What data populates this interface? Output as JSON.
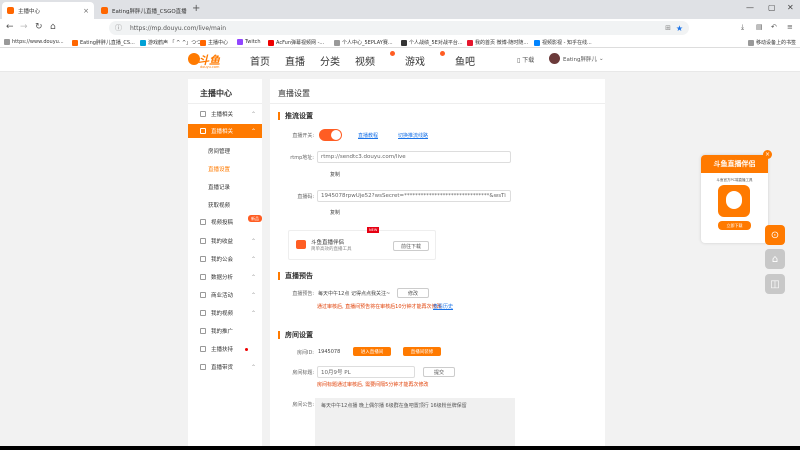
{
  "browser": {
    "tabs": [
      {
        "label": "主播中心",
        "active": true
      },
      {
        "label": "Eating胖胖儿直播_CSGO直播",
        "active": false
      }
    ],
    "url": "https://mp.douyu.com/live/main",
    "bookmarks": [
      "https://www.douyu...",
      "Eating胖胖儿直播_CS...",
      "游戏鹤声 「 ^ ^」つつ...",
      "主播中心",
      "Twitch",
      "AcFun弹幕视频网 -...",
      "个人中心_5EPLAY赛...",
      "个人战绩_5E对战平台...",
      "我的首页 微博-随时随...",
      "视频影视 - 知乎在线...",
      "移动设备上的书签"
    ]
  },
  "site": {
    "logo": "斗鱼",
    "logo_sub": "douyu.com",
    "nav": [
      "首页",
      "直播",
      "分类",
      "视频",
      "游戏",
      "鱼吧"
    ],
    "download": "下载",
    "username": "Eating胖胖儿"
  },
  "sidebar": {
    "title": "主播中心",
    "items": [
      {
        "label": "主播相关"
      },
      {
        "label": "直播相关"
      },
      {
        "label": "视频投稿"
      },
      {
        "label": "我的收益"
      },
      {
        "label": "我的公会"
      },
      {
        "label": "数据分析"
      },
      {
        "label": "商业活动"
      },
      {
        "label": "我的视频"
      },
      {
        "label": "我的推广"
      },
      {
        "label": "主播扶持"
      },
      {
        "label": "直播带货"
      }
    ],
    "subitems": [
      "房间管理",
      "直播设置",
      "直播记录",
      "获取视频"
    ],
    "new_badge": "新品"
  },
  "main": {
    "title": "直播设置",
    "stream": {
      "section": "推流设置",
      "switch_label": "直播开关:",
      "link1": "直播教程",
      "link2": "切换推流线路",
      "rtmp_label": "rtmp地址:",
      "rtmp_value": "rtmp://sendtc3.douyu.com/live",
      "copy": "复制",
      "code_label": "直播码:",
      "code_value": "1945078rpwUje52?wsSecret=*******************************&wsTi",
      "copy2": "复制"
    },
    "promo": {
      "title": "斗鱼直播伴侣",
      "subtitle": "简单高效的直播工具",
      "download": "前往下载",
      "badge": "NEW"
    },
    "notice": {
      "section": "直播预告",
      "label": "直播预告:",
      "value": "每天中午12点  记得点点我关注~",
      "edit": "修改",
      "warn": "通过审核后, 直播间预告将在审核后10分钟才能再次修改",
      "history": "查看历史"
    },
    "room": {
      "section": "房间设置",
      "id_label": "房间ID:",
      "id_value": "1945078",
      "btn1": "进入直播间",
      "btn2": "直播间装修",
      "title_label": "房间标题:",
      "title_value": "10月9号 PL",
      "submit": "提交",
      "warn": "房间标题通过审核后, 需要间隔5分钟才能再次修改",
      "announce_label": "房间公告:",
      "announce_value": "每天中午12点播 晚上偶尔播 6级群在鱼吧置顶行 16级粉丝牌保留"
    }
  },
  "ad": {
    "title": "斗鱼直播伴侣",
    "subtitle": "斗鱼官方PC端直播工具",
    "button": "立即下载",
    "close": "×"
  }
}
